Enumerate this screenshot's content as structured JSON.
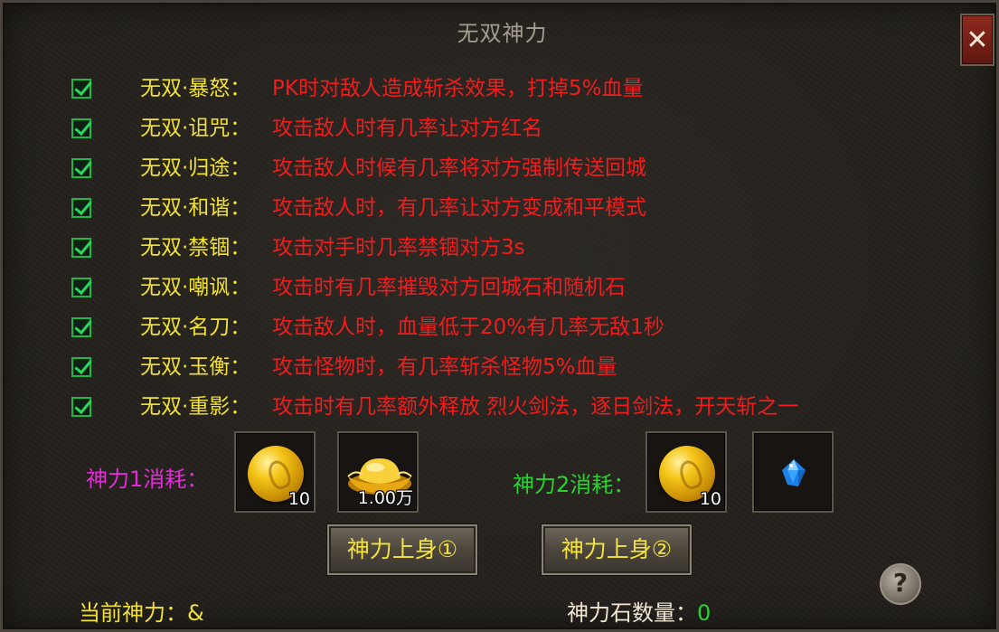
{
  "window": {
    "title": "无双神力",
    "close_glyph": "✕"
  },
  "skills": [
    {
      "name": "无双·暴怒：",
      "desc": "PK时对敌人造成斩杀效果，打掉5%血量",
      "checked": true
    },
    {
      "name": "无双·诅咒：",
      "desc": "攻击敌人时有几率让对方红名",
      "checked": true
    },
    {
      "name": "无双·归途：",
      "desc": "攻击敌人时候有几率将对方强制传送回城",
      "checked": true
    },
    {
      "name": "无双·和谐：",
      "desc": "攻击敌人时，有几率让对方变成和平模式",
      "checked": true
    },
    {
      "name": "无双·禁锢：",
      "desc": "攻击对手时几率禁锢对方3s",
      "checked": true
    },
    {
      "name": "无双·嘲讽：",
      "desc": "攻击时有几率摧毁对方回城石和随机石",
      "checked": true
    },
    {
      "name": "无双·名刀：",
      "desc": "攻击敌人时，血量低于20%有几率无敌1秒",
      "checked": true
    },
    {
      "name": "无双·玉衡：",
      "desc": "攻击怪物时，有几率斩杀怪物5%血量",
      "checked": true
    },
    {
      "name": "无双·重影：",
      "desc": "攻击时有几率额外释放 烈火剑法，逐日剑法，开天斩之一",
      "checked": true
    }
  ],
  "cost1": {
    "label": "神力1消耗：",
    "color": "#e42ad8",
    "items": [
      {
        "icon": "gold-coin-icon",
        "qty": "10"
      },
      {
        "icon": "gold-ingot-icon",
        "qty": "1.00万"
      }
    ]
  },
  "cost2": {
    "label": "神力2消耗：",
    "color": "#27d42b",
    "items": [
      {
        "icon": "gold-coin-icon",
        "qty": "10"
      },
      {
        "icon": "blue-gem-icon",
        "qty": ""
      }
    ]
  },
  "buttons": {
    "equip1": "神力上身①",
    "equip2": "神力上身②",
    "help": "?"
  },
  "footer": {
    "current_label": "当前神力：",
    "current_value": "&",
    "stone_label": "神力石数量：",
    "stone_value": "0"
  },
  "colors": {
    "skill_name": "#f2e12e",
    "skill_desc": "#f21c1c",
    "check": "#2bd65d",
    "footer_label": "#f0e6d2",
    "current_value": "#f2e12e",
    "stone_value": "#27d42b"
  }
}
